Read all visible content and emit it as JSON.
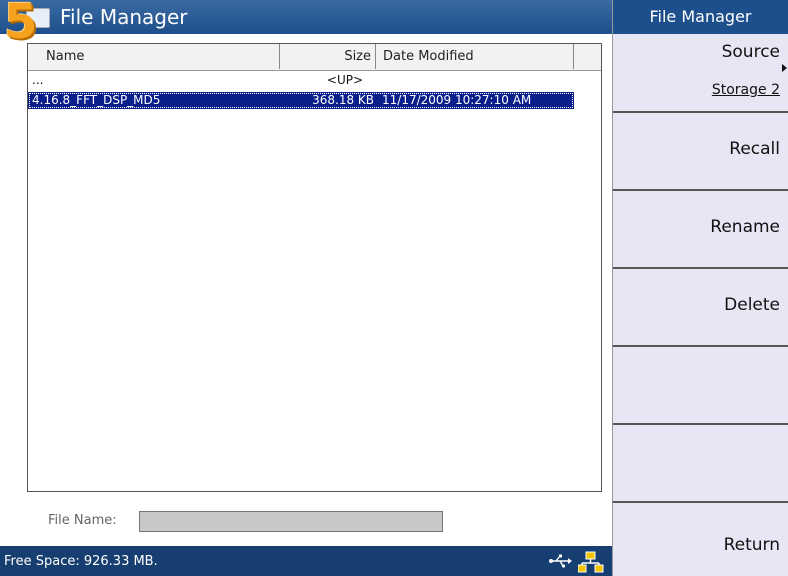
{
  "window": {
    "title": "File Manager",
    "step_number": "5"
  },
  "file_list": {
    "columns": {
      "name": "Name",
      "size": "Size",
      "date": "Date Modified"
    },
    "rows": [
      {
        "name": "...",
        "size": "<UP>",
        "date": ""
      },
      {
        "name": "4.16.8_FFT_DSP_MD5",
        "size": "368.18 KB",
        "date": "11/17/2009 10:27:10 AM"
      }
    ]
  },
  "file_name": {
    "label": "File Name:",
    "value": ""
  },
  "status": {
    "free_space": "Free Space: 926.33 MB."
  },
  "softkeys": {
    "title": "File Manager",
    "source": {
      "label": "Source",
      "value": "Storage 2"
    },
    "recall": "Recall",
    "rename": "Rename",
    "delete": "Delete",
    "blank1": "",
    "blank2": "",
    "return": "Return"
  },
  "colors": {
    "title_bar": "#1d4f8c",
    "status_bar": "#173e71",
    "selection": "#0a1e8c",
    "softkey_bg": "#e6e6f5",
    "badge": "#f7a21e"
  },
  "icons": [
    "app-icon",
    "usb-icon",
    "network-icon"
  ]
}
